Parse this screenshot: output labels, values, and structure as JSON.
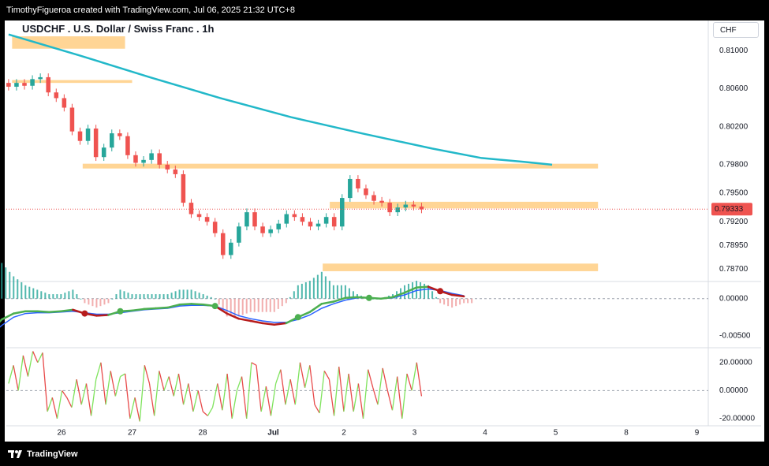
{
  "header": {
    "credit": "TimothyFigueroa created with TradingView.com, Jul 06, 2025 21:32 UTC+8"
  },
  "symbol_title": "USDCHF . U.S. Dollar / Swiss Franc . 1h",
  "currency_button": "CHF",
  "footer": {
    "brand": "TradingView",
    "logo_icon": "tradingview-logo-icon"
  },
  "colors": {
    "up": "#26a69a",
    "down": "#ef5350",
    "ma": "#22b8c9",
    "zone": "#ffd08a",
    "macd_fast": "#4caf50",
    "macd_slow": "#2962ff",
    "rsi_up": "#7ee35c",
    "rsi_down": "#e84a4a"
  },
  "chart_data": [
    {
      "type": "candlestick",
      "title": "USDCHF . U.S. Dollar / Swiss Franc . 1h",
      "price_scale_labels": [
        "0.81000",
        "0.80600",
        "0.80200",
        "0.79800",
        "0.79500",
        "0.79200",
        "0.78950",
        "0.78700"
      ],
      "ylim": [
        0.7858,
        0.8125
      ],
      "x_tick_labels": [
        "26",
        "27",
        "28",
        "Jul",
        "2",
        "3",
        "4",
        "5",
        "8",
        "9"
      ],
      "last_price": "0.79333",
      "series": [
        {
          "name": "moving_average",
          "points": [
            [
              0,
              0.8117
            ],
            [
              1,
              0.8095
            ],
            [
              2,
              0.8072
            ],
            [
              3,
              0.805
            ],
            [
              4,
              0.803
            ],
            [
              5,
              0.8013
            ],
            [
              6,
              0.7997
            ],
            [
              6.7,
              0.7987
            ],
            [
              7.3,
              0.7983
            ],
            [
              7.7,
              0.798
            ]
          ]
        }
      ],
      "candles_close": [
        0.8062,
        0.8066,
        0.8063,
        0.807,
        0.8072,
        0.8056,
        0.805,
        0.804,
        0.8015,
        0.8005,
        0.8018,
        0.7988,
        0.7998,
        0.8013,
        0.801,
        0.799,
        0.7982,
        0.7985,
        0.7992,
        0.798,
        0.7975,
        0.797,
        0.794,
        0.7928,
        0.7925,
        0.792,
        0.7908,
        0.7885,
        0.7898,
        0.7915,
        0.793,
        0.7915,
        0.7908,
        0.7912,
        0.7918,
        0.7928,
        0.7925,
        0.792,
        0.7915,
        0.7918,
        0.7925,
        0.7915,
        0.7945,
        0.7965,
        0.7955,
        0.7948,
        0.7942,
        0.794,
        0.793,
        0.7935,
        0.7938,
        0.7936,
        0.7933
      ],
      "zones": [
        {
          "from_x": -0.7,
          "to_x": 0.9,
          "low": 0.8102,
          "high": 0.8115
        },
        {
          "from_x": -0.7,
          "to_x": 1.0,
          "low": 0.8066,
          "high": 0.8069
        },
        {
          "from_x": 0.3,
          "to_x": 7.6,
          "low": 0.7976,
          "high": 0.7981
        },
        {
          "from_x": 3.8,
          "to_x": 7.6,
          "low": 0.7934,
          "high": 0.7941
        },
        {
          "from_x": 3.7,
          "to_x": 7.6,
          "low": 0.7868,
          "high": 0.7876
        }
      ]
    },
    {
      "type": "line",
      "title": "",
      "y_tick_labels": [
        "0.00000",
        "-0.00500"
      ],
      "ylim": [
        -0.0065,
        0.0022
      ],
      "series": [
        {
          "name": "",
          "color": "#4caf50",
          "values": [
            -0.0055,
            -0.0057,
            -0.0045,
            -0.0028,
            -0.002,
            -0.0017,
            -0.0017,
            -0.0018,
            -0.0017,
            -0.0015,
            -0.002,
            -0.0023,
            -0.0022,
            -0.0017,
            -0.0016,
            -0.0014,
            -0.0013,
            -0.0012,
            -0.0008,
            -0.0007,
            -0.0008,
            -0.001,
            -0.002,
            -0.0027,
            -0.003,
            -0.0033,
            -0.0035,
            -0.0033,
            -0.0025,
            -0.0018,
            -0.0007,
            -0.0004,
            0.0001,
            0.0002,
            0.0001,
            0.0,
            0.0002,
            0.0008,
            0.0015,
            0.0016,
            0.001,
            0.0005,
            0.0003
          ]
        },
        {
          "name": "",
          "color": "#2962ff",
          "values": [
            -0.005,
            -0.0056,
            -0.005,
            -0.0036,
            -0.0025,
            -0.002,
            -0.0019,
            -0.0019,
            -0.0018,
            -0.0017,
            -0.0019,
            -0.0021,
            -0.0021,
            -0.0019,
            -0.0017,
            -0.0015,
            -0.0014,
            -0.0013,
            -0.001,
            -0.0009,
            -0.0009,
            -0.001,
            -0.0016,
            -0.0023,
            -0.0027,
            -0.003,
            -0.0032,
            -0.0032,
            -0.0028,
            -0.0022,
            -0.0013,
            -0.0007,
            -0.0002,
            0.0001,
            0.0001,
            0.0,
            0.0001,
            0.0005,
            0.0011,
            0.0013,
            0.0011,
            0.0007,
            0.0004
          ]
        }
      ]
    },
    {
      "type": "line",
      "title": "",
      "y_tick_labels": [
        "20.00000",
        "0.00000",
        "-20.00000"
      ],
      "ylim": [
        -24,
        30
      ],
      "values": [
        5,
        18,
        0,
        25,
        10,
        28,
        20,
        27,
        -15,
        -5,
        -20,
        0,
        -5,
        -12,
        8,
        -10,
        5,
        -18,
        8,
        20,
        -10,
        14,
        -4,
        10,
        12,
        -20,
        -5,
        -22,
        18,
        5,
        -18,
        14,
        0,
        10,
        -4,
        12,
        -10,
        5,
        -15,
        0,
        -15,
        -18,
        -12,
        5,
        -14,
        12,
        -20,
        0,
        10,
        -20,
        20,
        18,
        -15,
        3,
        -18,
        5,
        15,
        -10,
        8,
        -10,
        20,
        2,
        18,
        -10,
        -16,
        14,
        8,
        -18,
        17,
        -15,
        12,
        -15,
        5,
        -20,
        15,
        2,
        -10,
        16,
        0,
        -14,
        10,
        -20,
        12,
        0,
        20,
        -4
      ]
    }
  ]
}
